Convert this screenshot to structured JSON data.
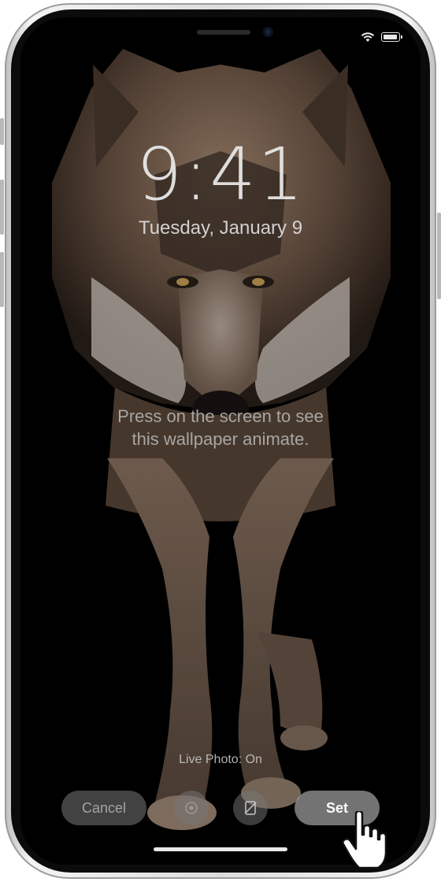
{
  "lockscreen": {
    "time": "9:41",
    "date": "Tuesday, January 9"
  },
  "hint": {
    "line1": "Press on the screen to see",
    "line2": "this wallpaper animate."
  },
  "live_photo": {
    "label": "Live Photo: On"
  },
  "actions": {
    "cancel_label": "Cancel",
    "set_label": "Set",
    "perspective_icon": "perspective-zoom-icon",
    "live_toggle_icon": "live-photo-toggle-icon"
  },
  "status_bar": {
    "icons": [
      "wifi-icon",
      "battery-icon"
    ]
  },
  "colors": {
    "accent_button": "#a0a0a0",
    "text": "#ebebeb"
  }
}
